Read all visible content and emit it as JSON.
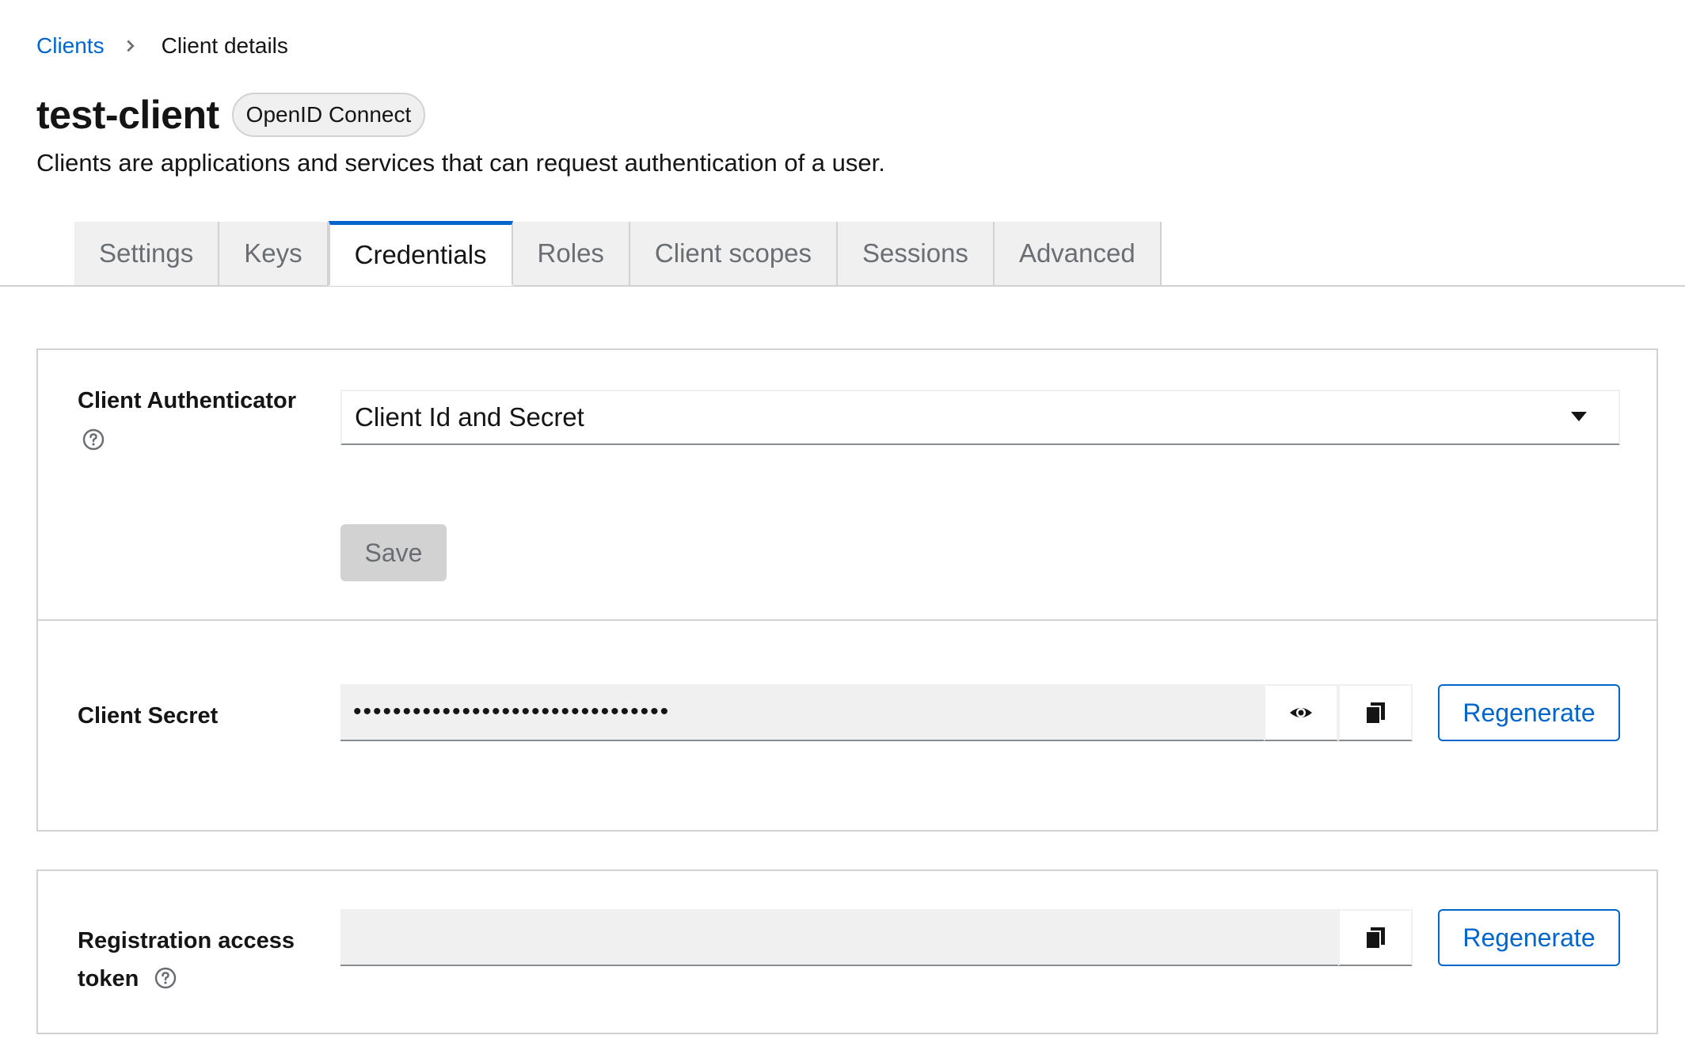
{
  "breadcrumb": {
    "root": "Clients",
    "current": "Client details"
  },
  "header": {
    "title": "test-client",
    "protocol_badge": "OpenID Connect",
    "subtitle": "Clients are applications and services that can request authentication of a user."
  },
  "tabs": [
    {
      "label": "Settings",
      "active": false
    },
    {
      "label": "Keys",
      "active": false
    },
    {
      "label": "Credentials",
      "active": true
    },
    {
      "label": "Roles",
      "active": false
    },
    {
      "label": "Client scopes",
      "active": false
    },
    {
      "label": "Sessions",
      "active": false
    },
    {
      "label": "Advanced",
      "active": false
    }
  ],
  "credentials": {
    "client_authenticator": {
      "label": "Client Authenticator",
      "selected": "Client Id and Secret",
      "help_icon": "help-circle-icon"
    },
    "save_label": "Save",
    "client_secret": {
      "label": "Client Secret",
      "masked_value": "••••••••••••••••••••••••••••••••",
      "regenerate_label": "Regenerate",
      "show_icon": "eye-icon",
      "copy_icon": "copy-icon"
    },
    "registration_token": {
      "label_line1": "Registration access",
      "label_line2": "token",
      "value": "",
      "regenerate_label": "Regenerate",
      "copy_icon": "copy-icon",
      "help_icon": "help-circle-icon"
    }
  },
  "colors": {
    "accent": "#0066cc",
    "tab_inactive_bg": "#f0f0f0",
    "border": "#d2d2d2",
    "disabled_bg": "#d2d2d2"
  }
}
